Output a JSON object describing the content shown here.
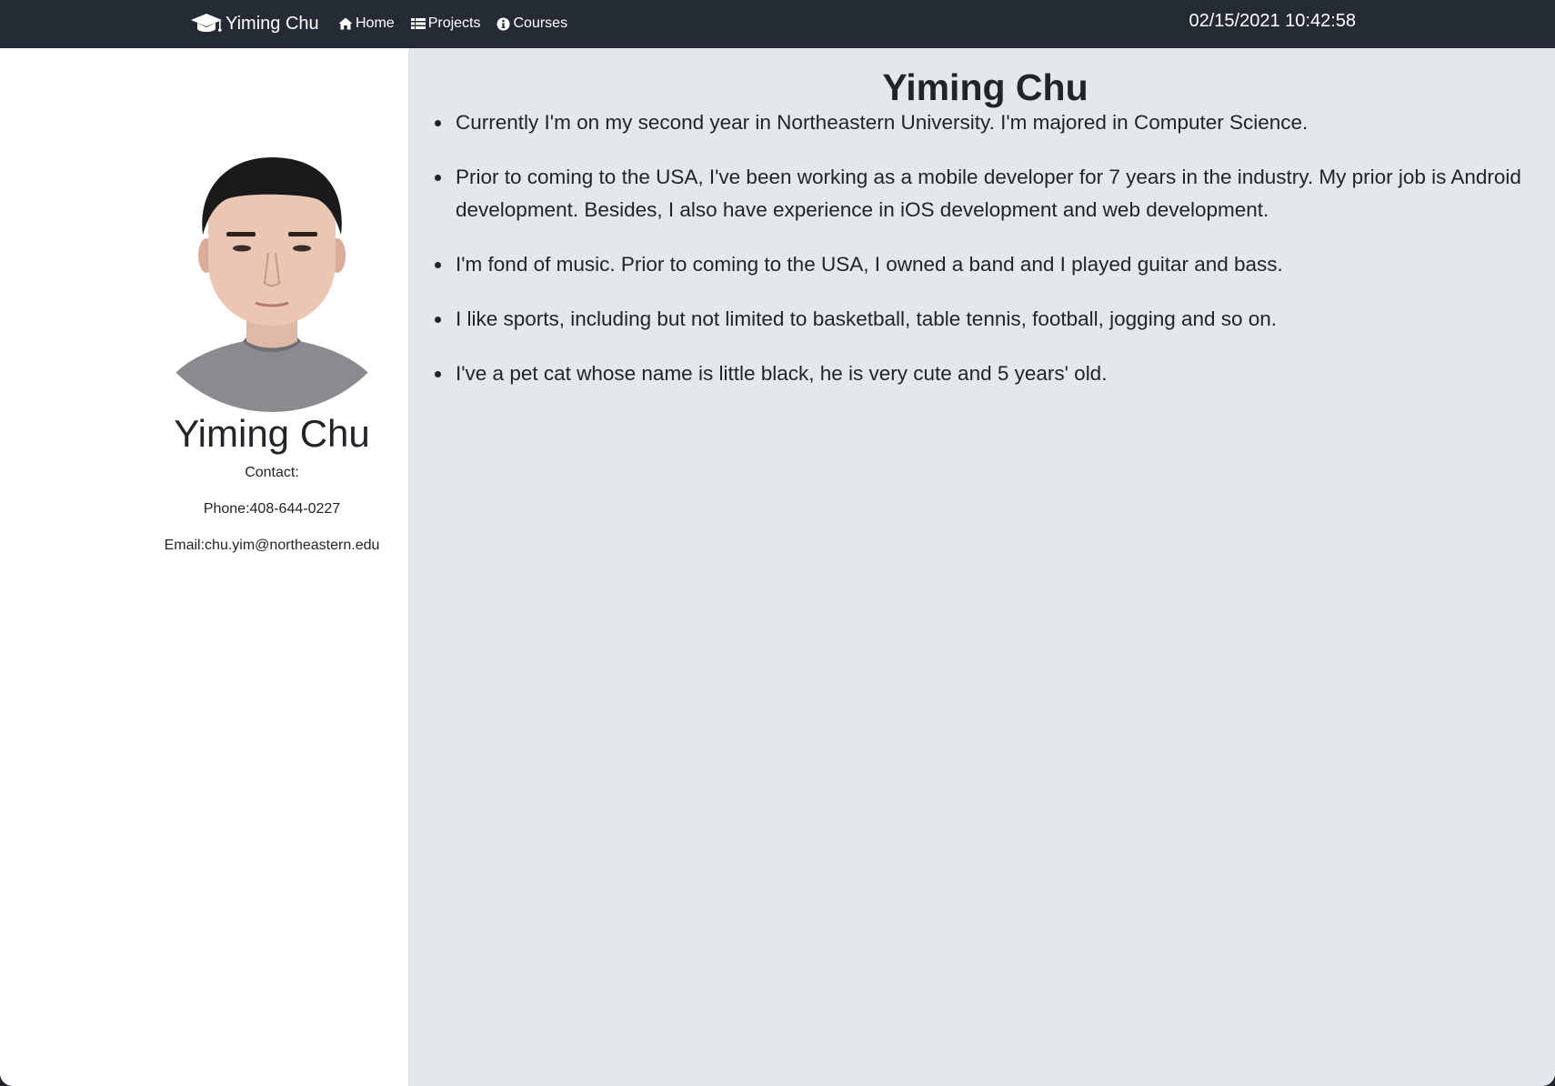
{
  "navbar": {
    "brand_label": "Yiming Chu",
    "links": [
      {
        "label": "Home",
        "icon": "home-icon"
      },
      {
        "label": "Projects",
        "icon": "list-icon"
      },
      {
        "label": "Courses",
        "icon": "info-icon"
      }
    ],
    "clock": "02/15/2021 10:42:58"
  },
  "sidebar": {
    "name": "Yiming Chu",
    "contact_heading": "Contact:",
    "phone": "Phone:408-644-0227",
    "email": "Email:chu.yim@northeastern.edu"
  },
  "main": {
    "title": "Yiming Chu",
    "bio": [
      "Currently I'm on my second year in Northeastern University. I'm majored in Computer Science.",
      "Prior to coming to the USA, I've been working as a mobile developer for 7 years in the industry. My prior job is Android development. Besides, I also have experience in iOS development and web development.",
      "I'm fond of music. Prior to coming to the USA, I owned a band and I played guitar and bass.",
      "I like sports, including but not limited to basketball, table tennis, football, jogging and so on.",
      "I've a pet cat whose name is little black, he is very cute and 5 years' old."
    ]
  },
  "colors": {
    "navbar_bg": "#252b35",
    "sidebar_bg": "#ffffff",
    "main_bg": "#e5e8eb",
    "text": "#212529"
  }
}
